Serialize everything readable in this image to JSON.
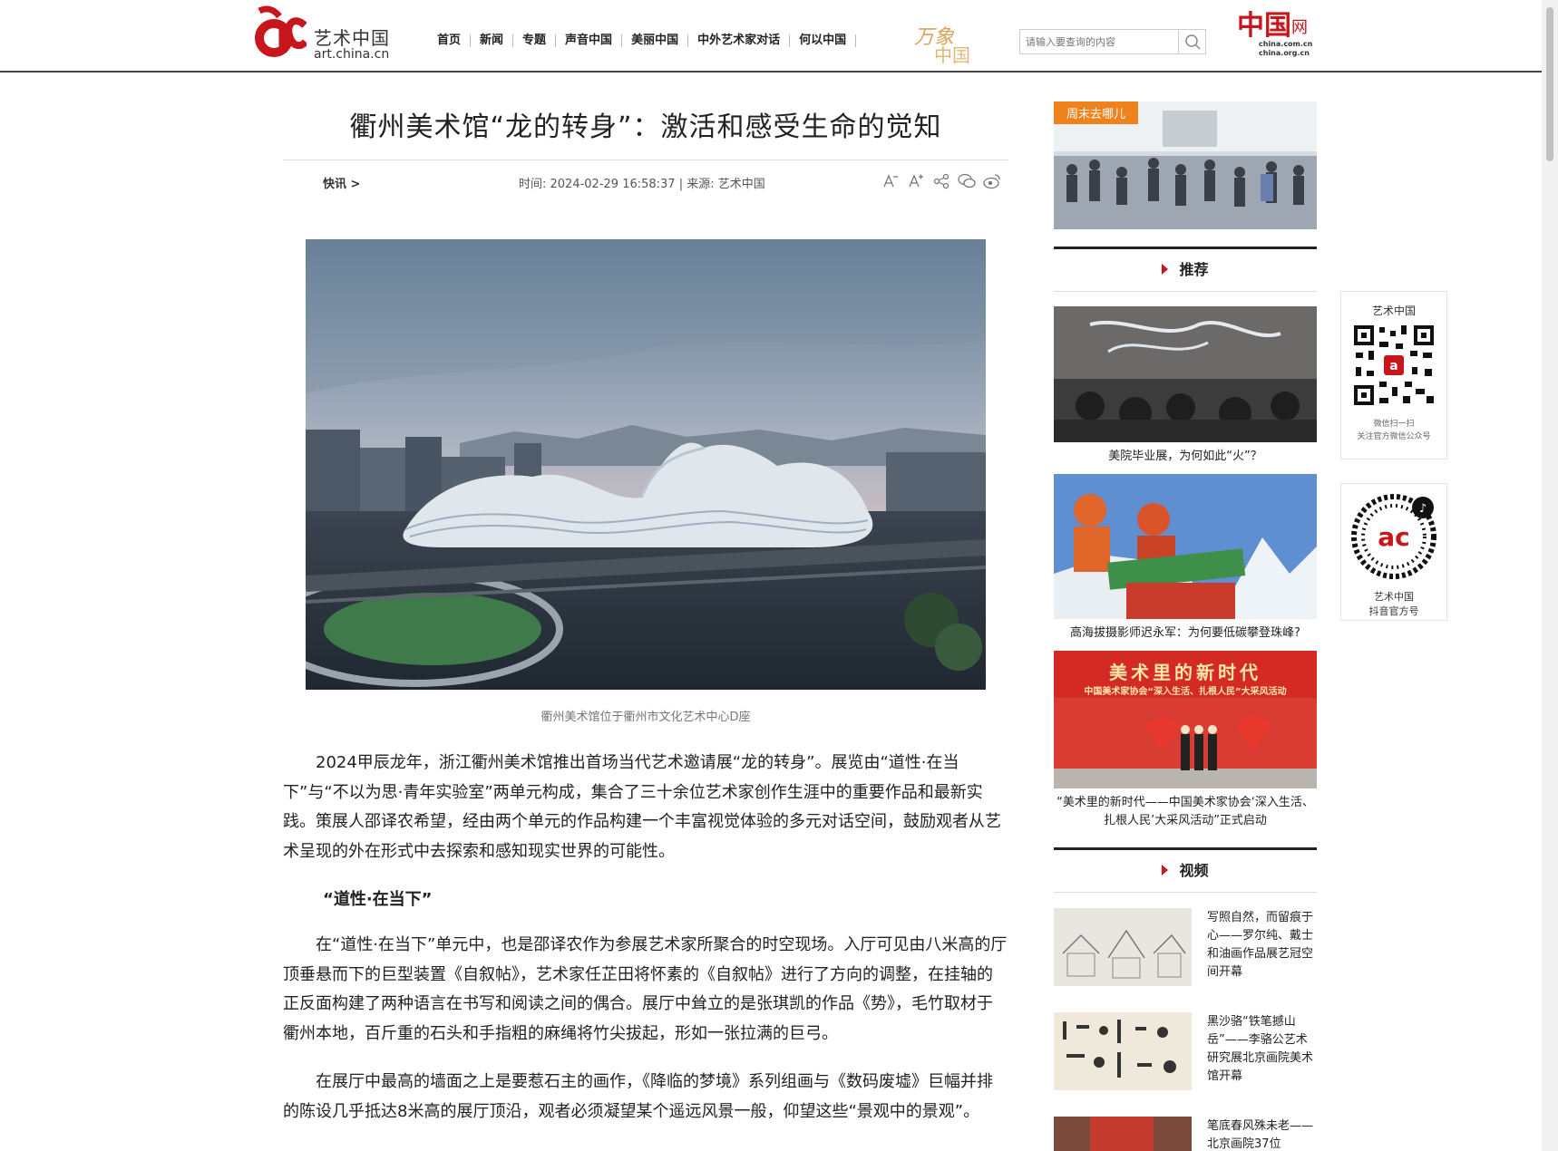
{
  "header": {
    "logo_cn": "艺术中国",
    "logo_en": "art.china.cn",
    "nav": [
      "首页",
      "新闻",
      "专题",
      "声音中国",
      "美丽中国",
      "中外艺术家对话",
      "何以中国"
    ],
    "promo_text": "万象中国",
    "search_placeholder": "请输入要查询的内容",
    "china_logo_text": "中国网",
    "china_logo_sub1": "china.com.cn",
    "china_logo_sub2": "china.org.cn"
  },
  "article": {
    "title": "衢州美术馆“龙的转身”：激活和感受生命的觉知",
    "breadcrumb": "快讯 >",
    "time_source": "时间: 2024-02-29 16:58:37 | 来源: 艺术中国",
    "tools": [
      "font-decrease-icon",
      "font-increase-icon",
      "share-icon",
      "wechat-icon",
      "weibo-icon"
    ],
    "photo_caption": "衢州美术馆位于衢州市文化艺术中心D座",
    "p1": "2024甲辰龙年，浙江衢州美术馆推出首场当代艺术邀请展“龙的转身”。展览由“道性·在当下”与“不以为思·青年实验室”两单元构成，集合了三十余位艺术家创作生涯中的重要作品和最新实践。策展人邵译农希望，经由两个单元的作品构建一个丰富视觉体验的多元对话空间，鼓励观者从艺术呈现的外在形式中去探索和感知现实世界的可能性。",
    "subhead": "“道性·在当下”",
    "p2": "在“道性·在当下”单元中，也是邵译农作为参展艺术家所聚合的时空现场。入厅可见由八米高的厅顶垂悬而下的巨型装置《自叙帖》，艺术家任芷田将怀素的《自叙帖》进行了方向的调整，在挂轴的正反面构建了两种语言在书写和阅读之间的偶合。展厅中耸立的是张琪凯的作品《势》，毛竹取材于衢州本地，百斤重的石头和手指粗的麻绳将竹尖拔起，形如一张拉满的巨弓。",
    "p3": "在展厅中最高的墙面之上是要惹石主的画作，《降临的梦境》系列组画与《数码废墟》巨幅并排的陈设几乎抵达8米高的展厅顶沿，观者必须凝望某个遥远风景一般，仰望这些“景观中的景观”。"
  },
  "sidebar": {
    "weekend_tag": "周末去哪儿",
    "recommend_title": "推荐",
    "recommend": [
      {
        "caption": "美院毕业展，为何如此“火”？"
      },
      {
        "caption": "高海拔摄影师迟永军：为何要低碳攀登珠峰?"
      },
      {
        "banner_title": "美术里的新时代",
        "banner_sub": "中国美术家协会“深入生活、扎根人民”大采风活动",
        "caption": "“美术里的新时代——中国美术家协会‘深入生活、扎根人民’大采风活动”正式启动"
      }
    ],
    "video_title": "视频",
    "videos": [
      {
        "text": "写照自然，而留痕于心——罗尔纯、戴士和油画作品展艺冠空间开幕"
      },
      {
        "text": "黑沙骆“铁笔撼山岳”——李骆公艺术研究展北京画院美术馆开幕"
      },
      {
        "text": "笔底春风殊未老——北京画院37位"
      }
    ]
  },
  "qr_cards": [
    {
      "title": "艺术中国",
      "line1": "微信扫一扫",
      "line2": "关注官方微信公众号"
    },
    {
      "title": "艺术中国",
      "line1": "抖音官方号"
    }
  ],
  "colors": {
    "brand_red": "#c8161d",
    "weekend_orange": "#f0821e"
  }
}
